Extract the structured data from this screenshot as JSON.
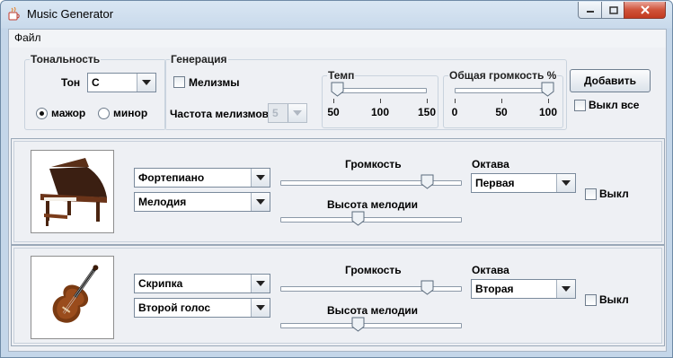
{
  "window": {
    "title": "Music Generator",
    "icon": "java-coffee-icon"
  },
  "menu": {
    "file": "Файл"
  },
  "tonality": {
    "group_label": "Тональность",
    "tone_label": "Тон",
    "tone_value": "C",
    "major_label": "мажор",
    "minor_label": "минор",
    "selected": "major"
  },
  "generation": {
    "group_label": "Генерация",
    "melismas_label": "Мелизмы",
    "melismas_checked": false,
    "melisma_freq_label": "Частота мелизмов",
    "melisma_freq_value": "5",
    "tempo": {
      "label": "Темп",
      "min": 50,
      "max": 150,
      "value": 55,
      "ticks": [
        "50",
        "100",
        "150"
      ]
    },
    "volume": {
      "label": "Общая громкость %",
      "min": 0,
      "max": 100,
      "value": 100,
      "ticks": [
        "0",
        "50",
        "100"
      ]
    }
  },
  "actions": {
    "add_button": "Добавить",
    "mute_all_label": "Выкл все",
    "mute_all_checked": false
  },
  "instruments": [
    {
      "picture": "grand-piano-image",
      "instrument": "Фортепиано",
      "role": "Мелодия",
      "volume_label": "Громкость",
      "volume_value": 0.81,
      "pitch_label": "Высота мелодии",
      "pitch_value": 0.43,
      "octave_label": "Октава",
      "octave_value": "Первая",
      "mute_label": "Выкл",
      "mute_checked": false
    },
    {
      "picture": "violin-image",
      "instrument": "Скрипка",
      "role": "Второй голос",
      "volume_label": "Громкость",
      "volume_value": 0.81,
      "pitch_label": "Высота мелодии",
      "pitch_value": 0.43,
      "octave_label": "Октава",
      "octave_value": "Вторая",
      "mute_label": "Выкл",
      "mute_checked": false
    }
  ]
}
